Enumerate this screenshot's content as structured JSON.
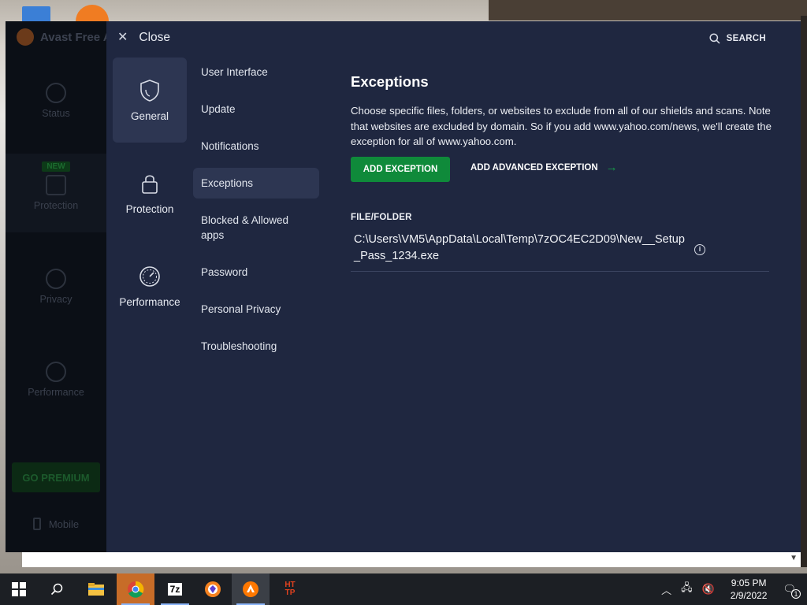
{
  "base_app": {
    "title": "Avast Free A",
    "nav": [
      {
        "label": "Status",
        "icon": "status-icon"
      },
      {
        "label": "Protection",
        "icon": "lock-icon",
        "badge": "NEW"
      },
      {
        "label": "Privacy",
        "icon": "fingerprint-icon"
      },
      {
        "label": "Performance",
        "icon": "speedometer-icon"
      }
    ],
    "go_premium": "GO PREMIUM",
    "mobile": "Mobile"
  },
  "settings": {
    "close_label": "Close",
    "search_label": "SEARCH",
    "categories": [
      {
        "label": "General",
        "icon": "shield-icon",
        "active": true
      },
      {
        "label": "Protection",
        "icon": "lock-icon",
        "active": false
      },
      {
        "label": "Performance",
        "icon": "speedometer-icon",
        "active": false
      }
    ],
    "subnav": [
      {
        "label": "User Interface",
        "active": false
      },
      {
        "label": "Update",
        "active": false
      },
      {
        "label": "Notifications",
        "active": false
      },
      {
        "label": "Exceptions",
        "active": true
      },
      {
        "label": "Blocked & Allowed apps",
        "active": false
      },
      {
        "label": "Password",
        "active": false
      },
      {
        "label": "Personal Privacy",
        "active": false
      },
      {
        "label": "Troubleshooting",
        "active": false
      }
    ],
    "content": {
      "heading": "Exceptions",
      "description": "Choose specific files, folders, or websites to exclude from all of our shields and scans. Note that websites are excluded by domain. So if you add www.yahoo.com/news, we'll create the exception for all of www.yahoo.com.",
      "add_button": "ADD EXCEPTION",
      "advanced_button": "ADD ADVANCED EXCEPTION",
      "column_header": "FILE/FOLDER",
      "exceptions": [
        {
          "path": "C:\\Users\\VM5\\AppData\\Local\\Temp\\7zOC4EC2D09\\New__Setup_Pass_1234.exe"
        }
      ]
    }
  },
  "taskbar": {
    "time": "9:05 PM",
    "date": "2/9/2022",
    "apps": [
      "file-explorer-icon",
      "chrome-icon",
      "7zip-icon",
      "brave-icon",
      "avast-icon",
      "http-toolkit-icon"
    ],
    "seven_zip_label": "7z",
    "http_label": "HT TP",
    "notification_count": "1"
  },
  "colors": {
    "overlay_bg": "#1f2740",
    "active_item_bg": "#2d3652",
    "accent_green": "#0f8a3a",
    "taskbar_bg": "#1c1f24"
  }
}
